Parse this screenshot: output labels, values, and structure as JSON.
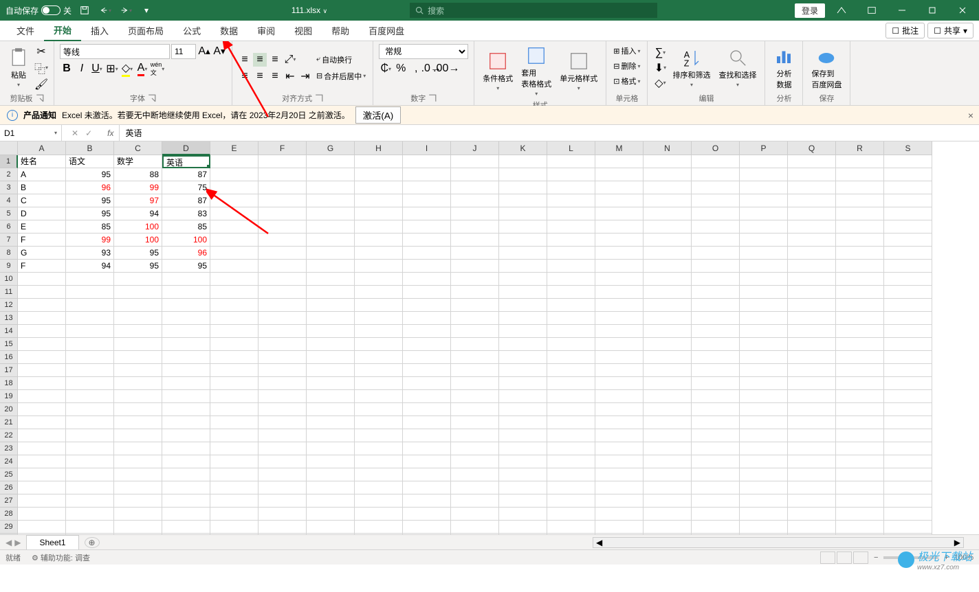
{
  "titlebar": {
    "autosave_label": "自动保存",
    "autosave_state": "关",
    "filename": "111.xlsx",
    "search_placeholder": "搜索",
    "login": "登录"
  },
  "tabs": {
    "file": "文件",
    "home": "开始",
    "insert": "插入",
    "layout": "页面布局",
    "formula": "公式",
    "data": "数据",
    "review": "审阅",
    "view": "视图",
    "help": "帮助",
    "netdisk": "百度网盘",
    "comment": "批注",
    "share": "共享"
  },
  "ribbon": {
    "clipboard": {
      "label": "剪贴板",
      "paste": "粘贴"
    },
    "font": {
      "label": "字体",
      "name": "等线",
      "size": "11"
    },
    "alignment": {
      "label": "对齐方式",
      "wrap": "自动换行",
      "merge": "合并后居中"
    },
    "number": {
      "label": "数字",
      "format": "常规"
    },
    "styles": {
      "label": "样式",
      "conditional": "条件格式",
      "table": "套用\n表格格式",
      "cell": "单元格样式"
    },
    "cells": {
      "label": "单元格",
      "insert": "插入",
      "delete": "删除",
      "format": "格式"
    },
    "editing": {
      "label": "编辑",
      "sort": "排序和筛选",
      "find": "查找和选择"
    },
    "analysis": {
      "label": "分析",
      "analyze": "分析\n数据"
    },
    "save": {
      "label": "保存",
      "netdisk": "保存到\n百度网盘"
    }
  },
  "notify": {
    "title": "产品通知",
    "msg": "Excel 未激活。若要无中断地继续使用 Excel，请在 2023年2月20日 之前激活。",
    "btn": "激活(A)"
  },
  "formula_bar": {
    "name_box": "D1",
    "formula": "英语"
  },
  "columns": [
    "A",
    "B",
    "C",
    "D",
    "E",
    "F",
    "G",
    "H",
    "I",
    "J",
    "K",
    "L",
    "M",
    "N",
    "O",
    "P",
    "Q",
    "R",
    "S"
  ],
  "selected_cell": "D1",
  "grid": {
    "headers": [
      "姓名",
      "语文",
      "数学",
      "英语"
    ],
    "rows": [
      {
        "name": "A",
        "yu": 95,
        "shu": 88,
        "ying": 87,
        "red": []
      },
      {
        "name": "B",
        "yu": 96,
        "shu": 99,
        "ying": 75,
        "red": [
          "yu",
          "shu"
        ]
      },
      {
        "name": "C",
        "yu": 95,
        "shu": 97,
        "ying": 87,
        "red": [
          "shu"
        ]
      },
      {
        "name": "D",
        "yu": 95,
        "shu": 94,
        "ying": 83,
        "red": []
      },
      {
        "name": "E",
        "yu": 85,
        "shu": 100,
        "ying": 85,
        "red": [
          "shu"
        ]
      },
      {
        "name": "F",
        "yu": 99,
        "shu": 100,
        "ying": 100,
        "red": [
          "yu",
          "shu",
          "ying"
        ]
      },
      {
        "name": "G",
        "yu": 93,
        "shu": 95,
        "ying": 96,
        "red": [
          "ying"
        ]
      },
      {
        "name": "F",
        "yu": 94,
        "shu": 95,
        "ying": 95,
        "red": []
      }
    ]
  },
  "sheet": {
    "name": "Sheet1"
  },
  "status": {
    "ready": "就绪",
    "a11y": "辅助功能: 调查",
    "zoom": "100%"
  },
  "watermark": {
    "text": "极光下载站",
    "url": "www.xz7.com"
  }
}
